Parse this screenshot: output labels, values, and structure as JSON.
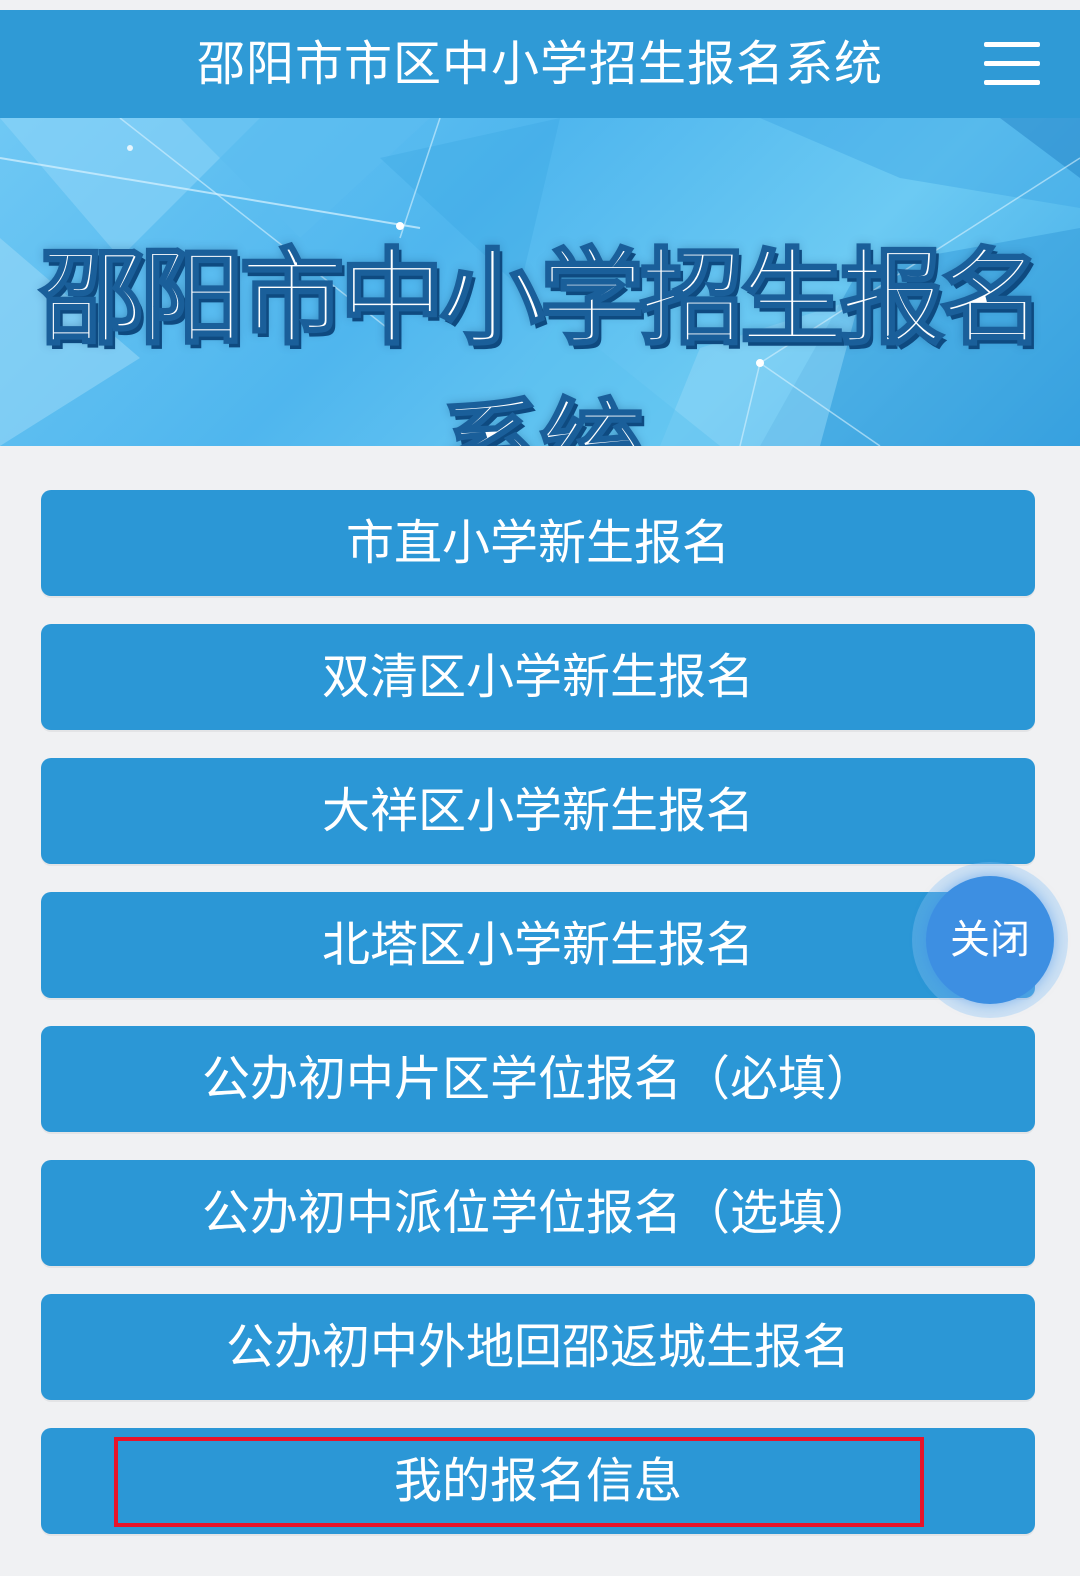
{
  "header": {
    "title": "邵阳市市区中小学招生报名系统",
    "menu_icon": "hamburger-menu-icon"
  },
  "banner": {
    "title": "邵阳市中小学招生报名系统"
  },
  "buttons": [
    {
      "label": "市直小学新生报名"
    },
    {
      "label": "双清区小学新生报名"
    },
    {
      "label": "大祥区小学新生报名"
    },
    {
      "label": "北塔区小学新生报名"
    },
    {
      "label": "公办初中片区学位报名（必填）"
    },
    {
      "label": "公办初中派位学位报名（选填）"
    },
    {
      "label": "公办初中外地回邵返城生报名"
    },
    {
      "label": "我的报名信息"
    }
  ],
  "floating": {
    "close_label": "关闭"
  },
  "colors": {
    "header_bg": "#2f9ad6",
    "button_bg": "#2b97d6",
    "page_bg": "#f0f1f3",
    "highlight_border": "#e8132a",
    "close_bg": "#3d8fe2"
  }
}
